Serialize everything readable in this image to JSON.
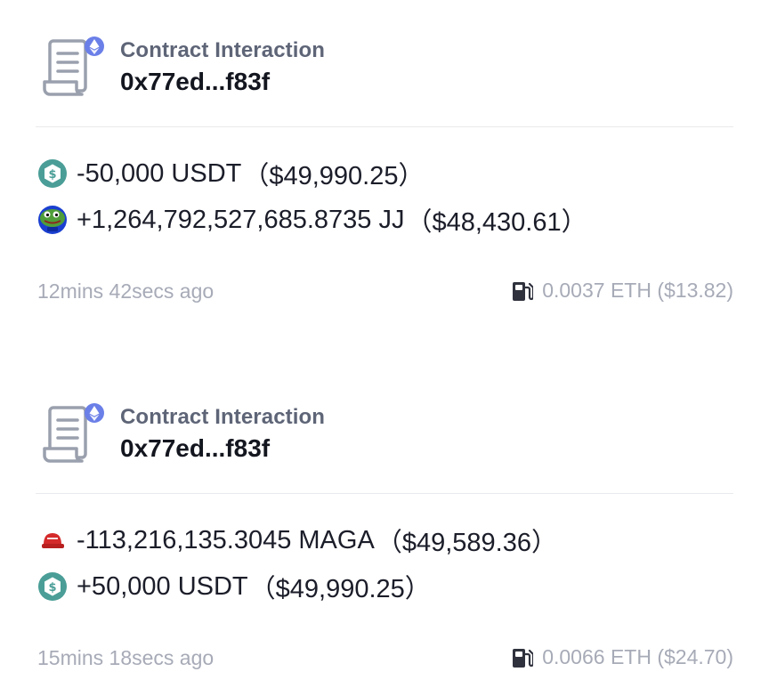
{
  "transactions": [
    {
      "type": "Contract Interaction",
      "address": "0x77ed...f83f",
      "chain_icon": "ethereum-icon",
      "transfers": [
        {
          "token_icon": "usdt-icon",
          "amount": "-50,000 USDT",
          "usd": "（$49,990.25）"
        },
        {
          "token_icon": "jj-frog-icon",
          "amount": "+1,264,792,527,685.8735 JJ",
          "usd": "（$48,430.61）"
        }
      ],
      "time": "12mins 42secs ago",
      "fee": "0.0037 ETH ($13.82)"
    },
    {
      "type": "Contract Interaction",
      "address": "0x77ed...f83f",
      "chain_icon": "ethereum-icon",
      "transfers": [
        {
          "token_icon": "maga-hat-icon",
          "amount": "-113,216,135.3045 MAGA",
          "usd": "（$49,589.36）"
        },
        {
          "token_icon": "usdt-icon",
          "amount": "+50,000 USDT",
          "usd": "（$49,990.25）"
        }
      ],
      "time": "15mins 18secs ago",
      "fee": "0.0066 ETH ($24.70)"
    }
  ],
  "colors": {
    "usdt": "#4a9e97",
    "eth_badge": "#6b7fe8",
    "muted_text": "#a7abb7",
    "type_text": "#5e6577",
    "maga_red": "#d42a2a",
    "frog_green": "#4f9e3a"
  }
}
